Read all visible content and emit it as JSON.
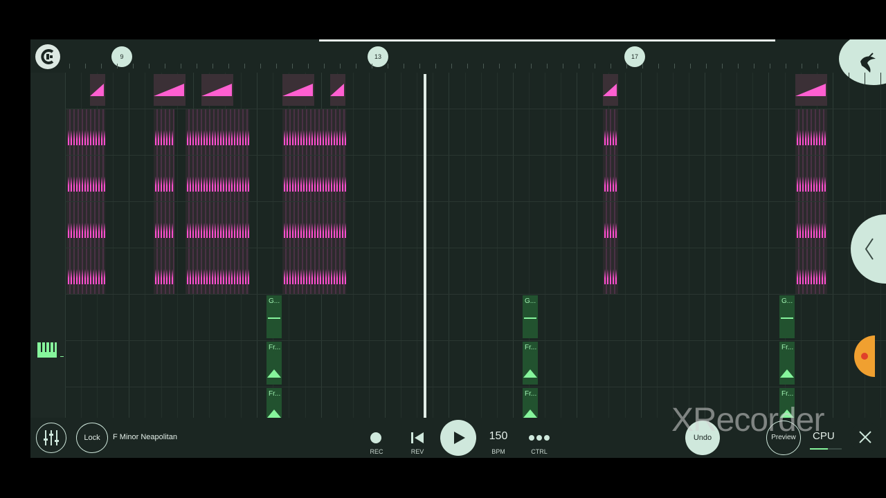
{
  "timeline": {
    "bar_markers": [
      "9",
      "13",
      "17"
    ]
  },
  "toolbar": {
    "lock_label": "Lock",
    "scale_label": "F Minor Neapolitan",
    "rec_label": "REC",
    "rev_label": "REV",
    "bpm_value": "150",
    "bpm_label": "BPM",
    "ctrl_label": "CTRL",
    "undo_label": "Undo",
    "preview_label": "Preview",
    "cpu_label": "CPU"
  },
  "patterns": {
    "g_label": "G...",
    "fr_label": "Fr..."
  },
  "watermark": "XRecorder",
  "colors": {
    "accent_pink": "#ff4fcf",
    "accent_green": "#86f59c",
    "bg": "#1b2622",
    "ui_light": "#cfe8dc"
  },
  "icons": [
    "logo-icon",
    "fl-fruit-icon",
    "mixer-icon",
    "record-icon",
    "rewind-icon",
    "play-icon",
    "more-icon",
    "close-icon",
    "chevron-left-icon",
    "piano-icon"
  ]
}
